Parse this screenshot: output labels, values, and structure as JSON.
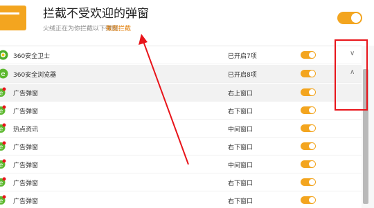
{
  "header": {
    "title": "拦截不受欢迎的弹窗",
    "subtitle": "火绒正在为你拦截以下弹窗",
    "link": "截图拦截",
    "master_toggle_on": true
  },
  "groups": [
    {
      "label": "360安全卫士",
      "status": "已开启7项",
      "on": true,
      "expanded": false,
      "icon": "360-guard-icon"
    },
    {
      "label": "360安全浏览器",
      "status": "已开启8项",
      "on": true,
      "expanded": true,
      "icon": "360-browser-icon"
    }
  ],
  "items": [
    {
      "label": "广告弹窗",
      "status": "右上窗口",
      "on": true
    },
    {
      "label": "广告弹窗",
      "status": "右下窗口",
      "on": true
    },
    {
      "label": "热点资讯",
      "status": "中间窗口",
      "on": true
    },
    {
      "label": "广告弹窗",
      "status": "右下窗口",
      "on": true
    },
    {
      "label": "广告弹窗",
      "status": "中间窗口",
      "on": true
    },
    {
      "label": "广告弹窗",
      "status": "右下窗口",
      "on": true
    },
    {
      "label": "广告弹窗",
      "status": "右下窗口",
      "on": true
    }
  ],
  "colors": {
    "accent": "#f3a51f",
    "annotation": "#e8141a",
    "link": "#e07a00"
  }
}
